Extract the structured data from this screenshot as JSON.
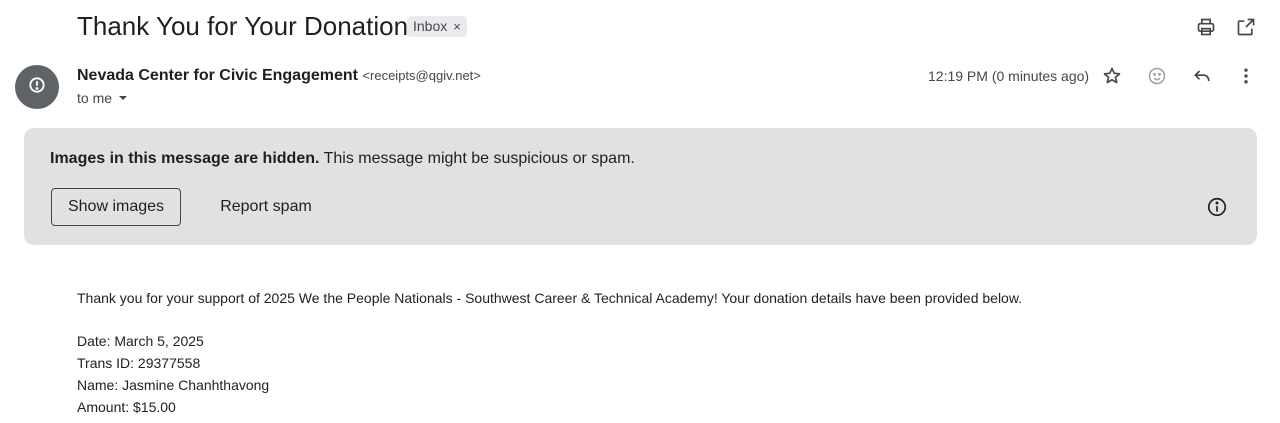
{
  "email": {
    "subject": "Thank You for Your Donation!",
    "label": "Inbox",
    "label_remove": "×",
    "sender_name": "Nevada Center for Civic Engagement",
    "sender_email": "<receipts@qgiv.net>",
    "recipient": "to me",
    "timestamp": "12:19 PM (0 minutes ago)"
  },
  "warning": {
    "bold_text": "Images in this message are hidden.",
    "text": "This message might be suspicious or spam.",
    "show_images": "Show images",
    "report_spam": "Report spam"
  },
  "body": {
    "intro": "Thank you for your support of 2025 We the People Nationals - Southwest Career & Technical Academy! Your donation details have been provided below.",
    "details": [
      "Date: March 5, 2025",
      "Trans ID: 29377558",
      "Name: Jasmine Chanhthavong",
      "Amount: $15.00"
    ]
  },
  "icons": {
    "print": "print-icon",
    "open_new_window": "open-in-new-window-icon",
    "star": "star-icon",
    "emoji": "emoji-reaction-icon",
    "reply": "reply-icon",
    "more": "more-vertical-icon",
    "avatar_alert": "alert-icon",
    "info": "info-icon",
    "dropdown": "chevron-down-icon"
  },
  "colors": {
    "warning_background": "#e1e1e1",
    "avatar_background": "#5f6368",
    "label_chip": "#e8eaed"
  }
}
